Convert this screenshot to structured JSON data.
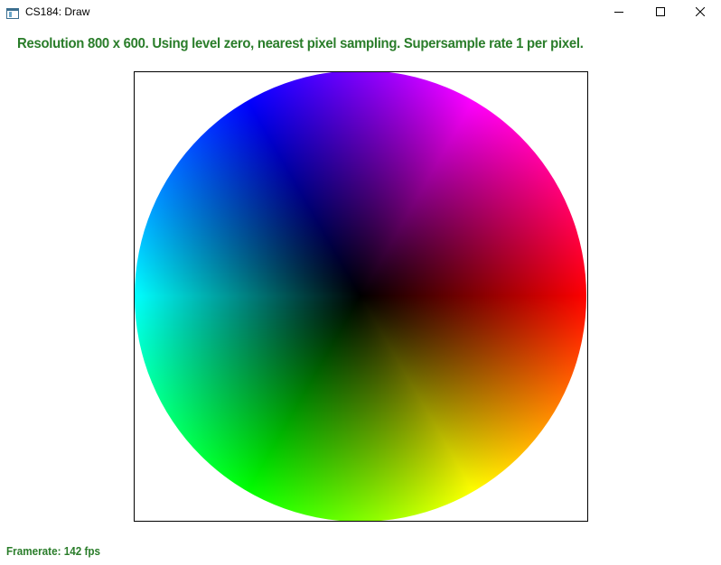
{
  "window": {
    "title": "CS184: Draw",
    "icon": "app-window-icon",
    "controls": {
      "minimize_icon": "minimize-icon",
      "maximize_icon": "maximize-icon",
      "close_icon": "close-icon"
    }
  },
  "status": {
    "text": "Resolution 800 x 600. Using level zero, nearest pixel sampling. Supersample rate 1 per pixel.",
    "color": "#2a7d2a"
  },
  "canvas": {
    "content": "color-wheel",
    "border_color": "#000000"
  },
  "footer": {
    "framerate_text": "Framerate: 142 fps"
  }
}
